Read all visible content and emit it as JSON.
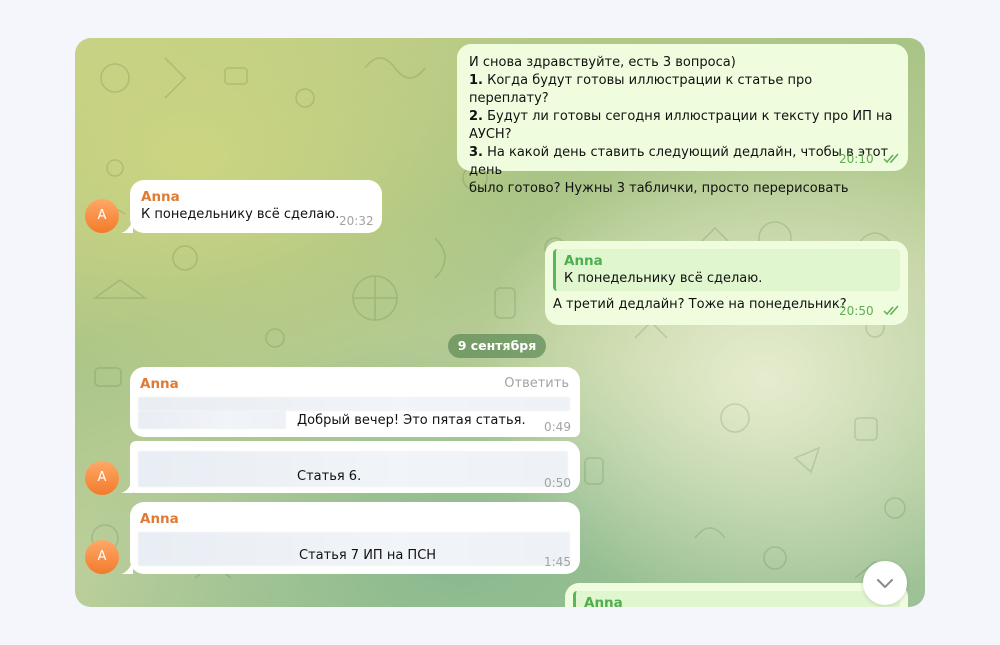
{
  "messages": {
    "msg1": {
      "intro": "И снова здравствуйте, есть 3 вопроса)",
      "q1_num": "1.",
      "q1_text": " Когда будут готовы иллюстрации к статье про переплату?",
      "q2_num": "2.",
      "q2_text_line1": " Будут ли готовы сегодня иллюстрации к тексту про ИП на",
      "q2_text_line2": "АУСН?",
      "q3_num": "3.",
      "q3_text_line1": " На какой день ставить следующий дедлайн, чтобы в этот день",
      "q3_text_line2": "было готово? Нужны 3 таблички, просто перерисовать",
      "time": "20:10"
    },
    "msg2": {
      "sender": "Anna",
      "text": "К понедельнику всё сделаю.",
      "time": "20:32"
    },
    "msg3": {
      "quote_sender": "Anna",
      "quote_text": "К понедельнику всё сделаю.",
      "text": "А третий дедлайн? Тоже на понедельник?",
      "time": "20:50"
    },
    "date_separator": "9 сентября",
    "msg4": {
      "sender": "Anna",
      "reply_label": "Ответить",
      "text": "Добрый вечер! Это пятая статья.",
      "time": "0:49"
    },
    "msg5": {
      "text": "Статья 6.",
      "time": "0:50"
    },
    "msg6": {
      "sender": "Anna",
      "text": "Статья 7 ИП на ПСН",
      "time": "1:45"
    },
    "msg7": {
      "quote_sender": "Anna"
    }
  },
  "avatar_letter": "A",
  "colors": {
    "incoming_bubble": "#ffffff",
    "outgoing_bubble": "#effdde",
    "sender_incoming": "#e07a34",
    "sender_outgoing": "#4fae4e",
    "read_checks": "#62ac55",
    "avatar": "#f27b2c"
  },
  "icons": {
    "read": "double-check-icon",
    "scroll_down": "chevron-down-icon"
  }
}
